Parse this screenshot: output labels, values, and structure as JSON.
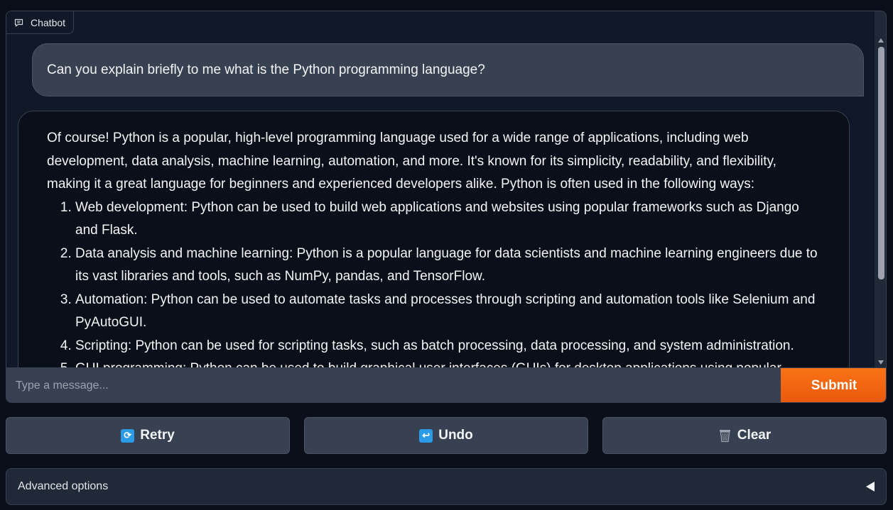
{
  "chatbot": {
    "tab_label": "Chatbot",
    "user_message": "Can you explain briefly to me what is the Python programming language?",
    "bot_intro": "Of course! Python is a popular, high-level programming language used for a wide range of applications, including web development, data analysis, machine learning, automation, and more. It's known for its simplicity, readability, and flexibility, making it a great language for beginners and experienced developers alike. Python is often used in the following ways:",
    "bot_list": [
      "Web development: Python can be used to build web applications and websites using popular frameworks such as Django and Flask.",
      "Data analysis and machine learning: Python is a popular language for data scientists and machine learning engineers due to its vast libraries and tools, such as NumPy, pandas, and TensorFlow.",
      "Automation: Python can be used to automate tasks and processes through scripting and automation tools like Selenium and PyAutoGUI.",
      "Scripting: Python can be used for scripting tasks, such as batch processing, data processing, and system administration.",
      "GUI programming: Python can be used to build graphical user interfaces (GUIs) for desktop applications using popular libraries"
    ]
  },
  "input": {
    "placeholder": "Type a message...",
    "submit_label": "Submit"
  },
  "actions": {
    "retry_label": "Retry",
    "undo_label": "Undo",
    "clear_label": "Clear"
  },
  "advanced": {
    "label": "Advanced options"
  },
  "colors": {
    "accent": "#f97316",
    "background": "#0b0f19",
    "panel": "#1f2937"
  },
  "icons": {
    "tab": "chat-bubble-icon",
    "retry": "retry-icon",
    "undo": "undo-icon",
    "clear": "trash-icon",
    "advanced": "collapse-arrow-icon"
  }
}
